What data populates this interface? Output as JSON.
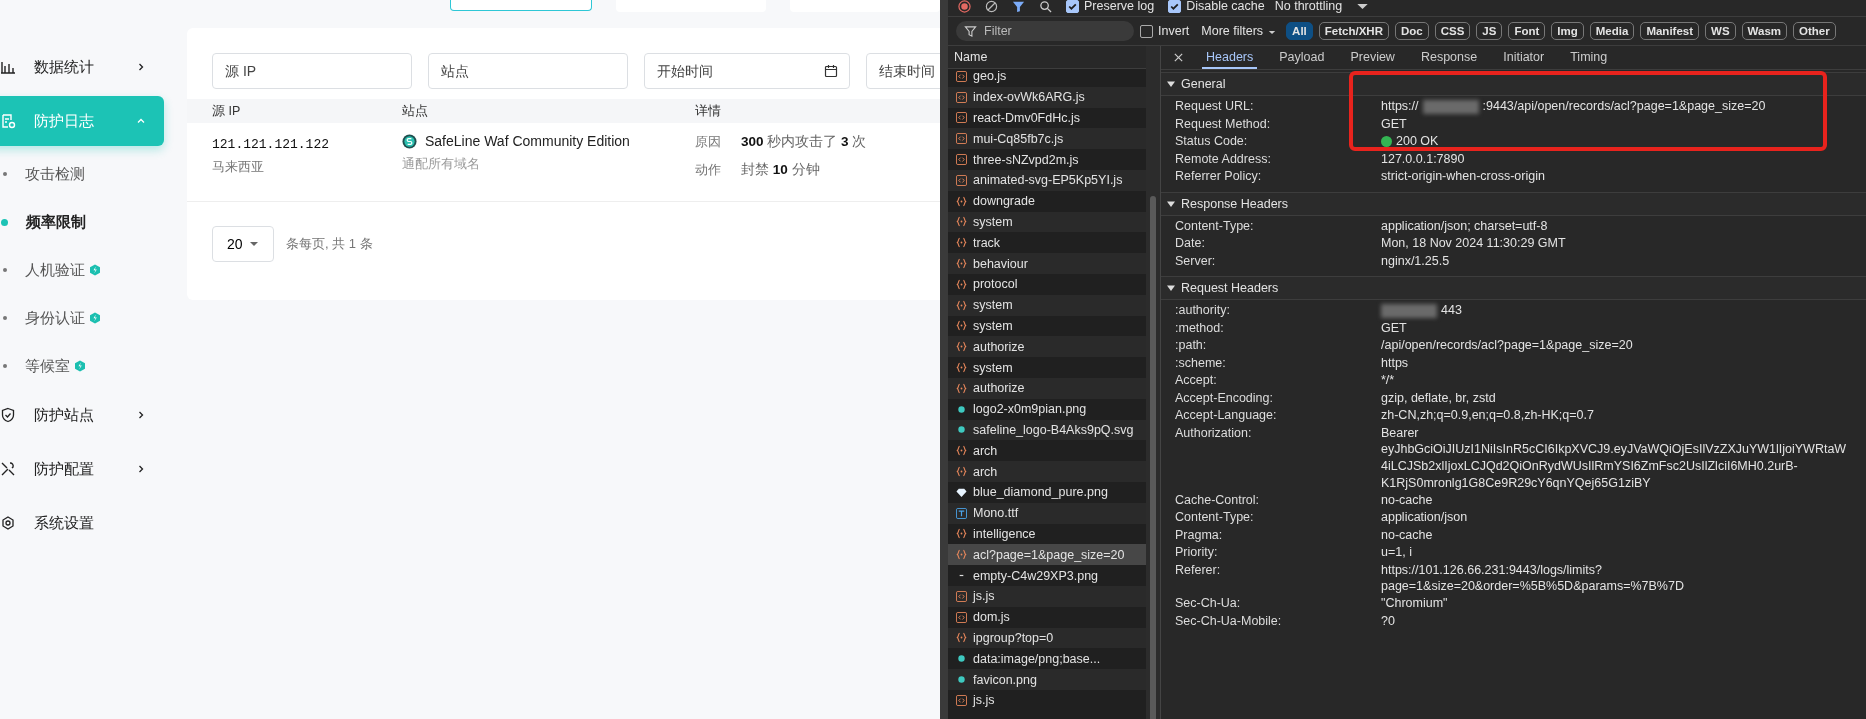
{
  "app": {
    "sidebar": {
      "items": [
        {
          "label": "数据统计",
          "kind": "group",
          "expanded": false,
          "selected": false
        },
        {
          "label": "防护日志",
          "kind": "group",
          "expanded": true,
          "selected": true,
          "children": [
            {
              "label": "攻击检测",
              "selected": false,
              "pro": false
            },
            {
              "label": "频率限制",
              "selected": true,
              "pro": false
            },
            {
              "label": "人机验证",
              "selected": false,
              "pro": true
            },
            {
              "label": "身份认证",
              "selected": false,
              "pro": true
            },
            {
              "label": "等候室",
              "selected": false,
              "pro": true
            }
          ]
        },
        {
          "label": "防护站点",
          "kind": "group",
          "expanded": false,
          "selected": false
        },
        {
          "label": "防护配置",
          "kind": "group",
          "expanded": false,
          "selected": false
        },
        {
          "label": "系统设置",
          "kind": "link",
          "selected": false
        }
      ]
    },
    "filters": [
      {
        "placeholder": "源 IP",
        "kind": "text"
      },
      {
        "placeholder": "站点",
        "kind": "text"
      },
      {
        "placeholder": "开始时间",
        "kind": "date"
      },
      {
        "placeholder": "结束时间",
        "kind": "text"
      }
    ],
    "table": {
      "columns": [
        "源 IP",
        "站点",
        "详情"
      ],
      "rows": [
        {
          "source_ip": "121.121.121.122",
          "location": "马来西亚",
          "site": "SafeLine Waf Community Edition",
          "site_domain": "通配所有域名",
          "reason_label": "原因",
          "reason": "**300** 秒内攻击了 **3** 次",
          "action_label": "动作",
          "action": "封禁 **10** 分钟"
        }
      ]
    },
    "pagination": {
      "page_size": "20",
      "summary": "条每页, 共 1 条"
    }
  },
  "devtools": {
    "toolbar": [
      {
        "label": "Preserve log",
        "checked": true
      },
      {
        "label": "Disable cache",
        "checked": true
      }
    ],
    "throttling": "No throttling",
    "filter": {
      "placeholder": "Filter",
      "invert": {
        "label": "Invert",
        "checked": false
      },
      "more_filters": "More filters",
      "types": [
        {
          "label": "All",
          "selected": true
        },
        {
          "label": "Fetch/XHR",
          "selected": false
        },
        {
          "label": "Doc",
          "selected": false
        },
        {
          "label": "CSS",
          "selected": false
        },
        {
          "label": "JS",
          "selected": false
        },
        {
          "label": "Font",
          "selected": false
        },
        {
          "label": "Img",
          "selected": false
        },
        {
          "label": "Media",
          "selected": false
        },
        {
          "label": "Manifest",
          "selected": false
        },
        {
          "label": "WS",
          "selected": false
        },
        {
          "label": "Wasm",
          "selected": false
        },
        {
          "label": "Other",
          "selected": false
        }
      ]
    },
    "requests_header": "Name",
    "requests": [
      {
        "name": "geo.js",
        "kind": "script",
        "selected": false
      },
      {
        "name": "index-ovWk6ARG.js",
        "kind": "script",
        "selected": false
      },
      {
        "name": "react-Dmv0FdHc.js",
        "kind": "script",
        "selected": false
      },
      {
        "name": "mui-Cq85fb7c.js",
        "kind": "script",
        "selected": false
      },
      {
        "name": "three-sNZvpd2m.js",
        "kind": "script",
        "selected": false
      },
      {
        "name": "animated-svg-EP5Kp5YI.js",
        "kind": "script",
        "selected": false
      },
      {
        "name": "downgrade",
        "kind": "fetch",
        "selected": false
      },
      {
        "name": "system",
        "kind": "fetch",
        "selected": false
      },
      {
        "name": "track",
        "kind": "fetch",
        "selected": false
      },
      {
        "name": "behaviour",
        "kind": "fetch",
        "selected": false
      },
      {
        "name": "protocol",
        "kind": "fetch",
        "selected": false
      },
      {
        "name": "system",
        "kind": "fetch",
        "selected": false
      },
      {
        "name": "system",
        "kind": "fetch",
        "selected": false
      },
      {
        "name": "authorize",
        "kind": "fetch",
        "selected": false
      },
      {
        "name": "system",
        "kind": "fetch",
        "selected": false
      },
      {
        "name": "authorize",
        "kind": "fetch",
        "selected": false
      },
      {
        "name": "logo2-x0m9pian.png",
        "kind": "image",
        "selected": false
      },
      {
        "name": "safeline_logo-B4Aks9pQ.svg",
        "kind": "image",
        "selected": false
      },
      {
        "name": "arch",
        "kind": "fetch",
        "selected": false
      },
      {
        "name": "arch",
        "kind": "fetch",
        "selected": false
      },
      {
        "name": "blue_diamond_pure.png",
        "kind": "diamond",
        "selected": false
      },
      {
        "name": "Mono.ttf",
        "kind": "font",
        "selected": false
      },
      {
        "name": "intelligence",
        "kind": "fetch",
        "selected": false
      },
      {
        "name": "acl?page=1&page_size=20",
        "kind": "fetch",
        "selected": true
      },
      {
        "name": "empty-C4w29XP3.png",
        "kind": "other",
        "selected": false
      },
      {
        "name": "js.js",
        "kind": "script",
        "selected": false
      },
      {
        "name": "dom.js",
        "kind": "script",
        "selected": false
      },
      {
        "name": "ipgroup?top=0",
        "kind": "fetch",
        "selected": false
      },
      {
        "name": "data:image/png;base...",
        "kind": "image",
        "selected": false
      },
      {
        "name": "favicon.png",
        "kind": "image",
        "selected": false
      },
      {
        "name": "js.js",
        "kind": "script",
        "selected": false
      }
    ],
    "tabs": [
      {
        "label": "Headers",
        "selected": true
      },
      {
        "label": "Payload",
        "selected": false
      },
      {
        "label": "Preview",
        "selected": false
      },
      {
        "label": "Response",
        "selected": false
      },
      {
        "label": "Initiator",
        "selected": false
      },
      {
        "label": "Timing",
        "selected": false
      }
    ],
    "sections": [
      {
        "title": "General",
        "expanded": true,
        "rows": [
          {
            "name": "Request URL:",
            "value": "https://",
            "redacted": true,
            "value_after": ":9443/api/open/records/acl?page=1&page_size=20"
          },
          {
            "name": "Request Method:",
            "value": "GET"
          },
          {
            "name": "Status Code:",
            "value": "200 OK",
            "kind": "status"
          },
          {
            "name": "Remote Address:",
            "value": "127.0.0.1:7890"
          },
          {
            "name": "Referrer Policy:",
            "value": "strict-origin-when-cross-origin"
          }
        ]
      },
      {
        "title": "Response Headers",
        "expanded": true,
        "rows": [
          {
            "name": "Content-Type:",
            "value": "application/json; charset=utf-8"
          },
          {
            "name": "Date:",
            "value": "Mon, 18 Nov 2024 11:30:29 GMT"
          },
          {
            "name": "Server:",
            "value": "nginx/1.25.5"
          }
        ]
      },
      {
        "title": "Request Headers",
        "expanded": true,
        "rows": [
          {
            "name": ":authority:",
            "value": "",
            "redacted": true,
            "value_after": "443"
          },
          {
            "name": ":method:",
            "value": "GET"
          },
          {
            "name": ":path:",
            "value": "/api/open/records/acl?page=1&page_size=20"
          },
          {
            "name": ":scheme:",
            "value": "https"
          },
          {
            "name": "Accept:",
            "value": "*/*"
          },
          {
            "name": "Accept-Encoding:",
            "value": "gzip, deflate, br, zstd"
          },
          {
            "name": "Accept-Language:",
            "value": "zh-CN,zh;q=0.9,en;q=0.8,zh-HK;q=0.7"
          },
          {
            "name": "Authorization:",
            "lines": [
              "Bearer",
              "eyJhbGciOiJIUzI1NiIsInR5cCI6IkpXVCJ9.eyJVaWQiOjEsIlVzZXJuYW1lIjoiYWRtaW",
              "4iLCJSb2xlIjoxLCJQd2QiOnRydWUsIlRmYSI6ZmFsc2UsIlZlciI6MH0.2urB-",
              "K1RjS0mronlg1G8Ce9R29cY6qnYQej65G1ziBY"
            ]
          },
          {
            "name": "Cache-Control:",
            "value": "no-cache"
          },
          {
            "name": "Content-Type:",
            "value": "application/json"
          },
          {
            "name": "Pragma:",
            "value": "no-cache"
          },
          {
            "name": "Priority:",
            "value": "u=1, i"
          },
          {
            "name": "Referer:",
            "lines": [
              "https://101.126.66.231:9443/logs/limits?",
              "page=1&size=20&order=%5B%5D&params=%7B%7D"
            ]
          },
          {
            "name": "Sec-Ch-Ua:",
            "value": "\"Chromium\""
          },
          {
            "name": "Sec-Ch-Ua-Mobile:",
            "value": "?0"
          }
        ]
      }
    ]
  }
}
